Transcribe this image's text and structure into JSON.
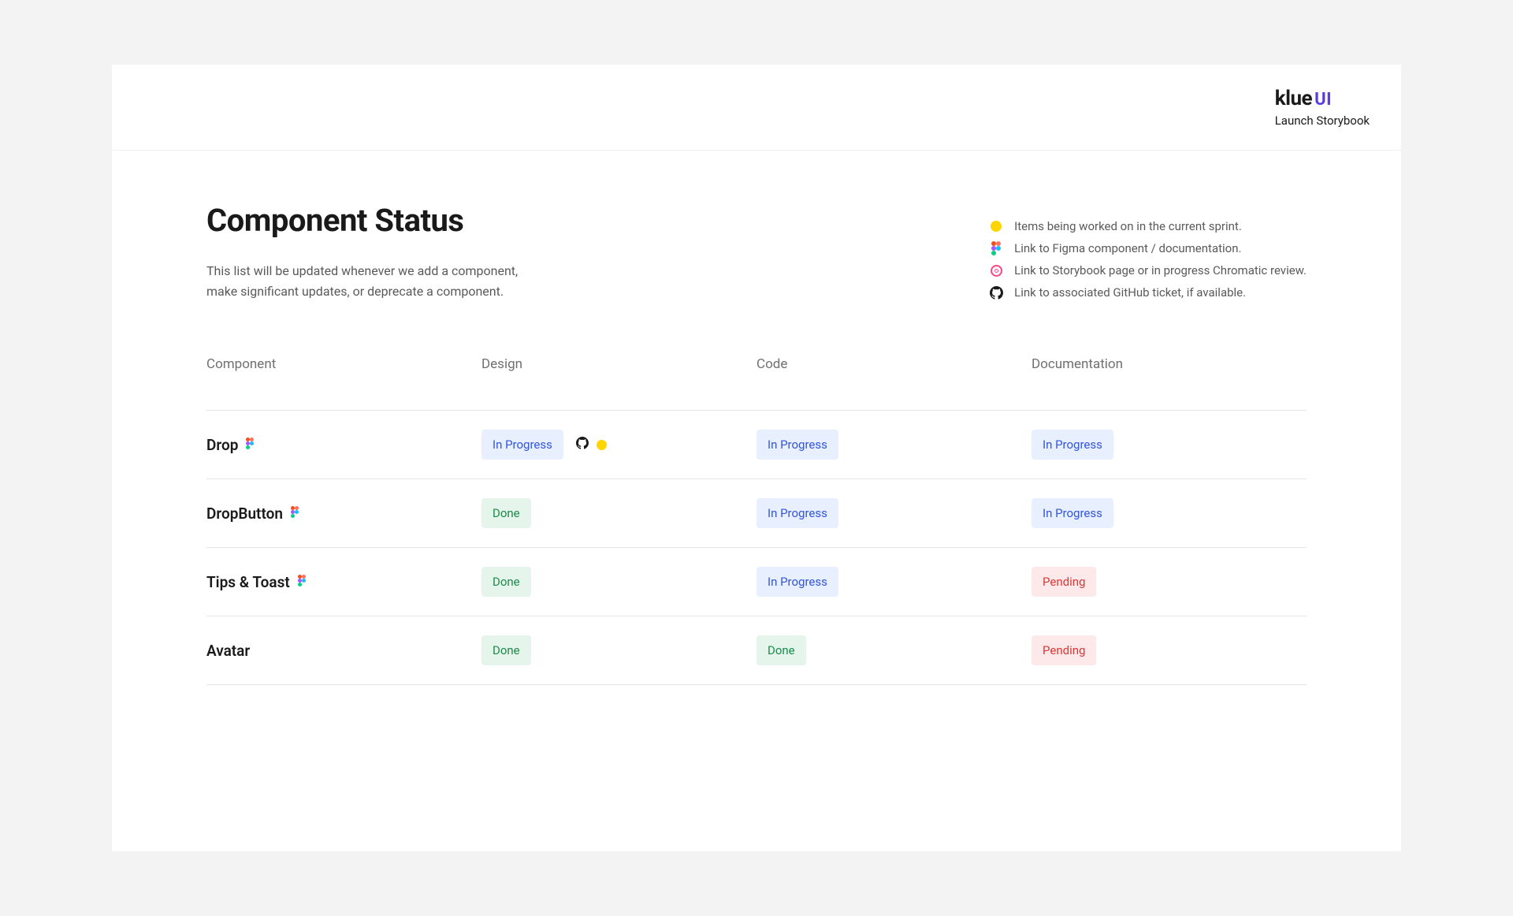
{
  "header": {
    "logo_primary": "klue",
    "logo_secondary": "UI",
    "launch_link": "Launch Storybook"
  },
  "page": {
    "title": "Component Status",
    "subtitle": "This list will be updated whenever we add a component, make significant updates, or deprecate a component."
  },
  "legend": {
    "sprint": "Items being worked on in the current sprint.",
    "figma": "Link to Figma component / documentation.",
    "storybook": "Link to Storybook page or in progress Chromatic review.",
    "github": "Link to associated GitHub ticket, if available."
  },
  "table": {
    "headers": {
      "component": "Component",
      "design": "Design",
      "code": "Code",
      "documentation": "Documentation"
    },
    "rows": [
      {
        "name": "Drop",
        "has_figma": true,
        "design": {
          "status": "In Progress",
          "has_github": true,
          "has_sprint": true
        },
        "code": {
          "status": "In Progress"
        },
        "documentation": {
          "status": "In Progress"
        }
      },
      {
        "name": "DropButton",
        "has_figma": true,
        "design": {
          "status": "Done"
        },
        "code": {
          "status": "In Progress"
        },
        "documentation": {
          "status": "In Progress"
        }
      },
      {
        "name": "Tips & Toast",
        "has_figma": true,
        "design": {
          "status": "Done"
        },
        "code": {
          "status": "In Progress"
        },
        "documentation": {
          "status": "Pending"
        }
      },
      {
        "name": "Avatar",
        "has_figma": false,
        "design": {
          "status": "Done"
        },
        "code": {
          "status": "Done"
        },
        "documentation": {
          "status": "Pending"
        }
      }
    ]
  },
  "status_labels": {
    "In Progress": "In Progress",
    "Done": "Done",
    "Pending": "Pending"
  }
}
